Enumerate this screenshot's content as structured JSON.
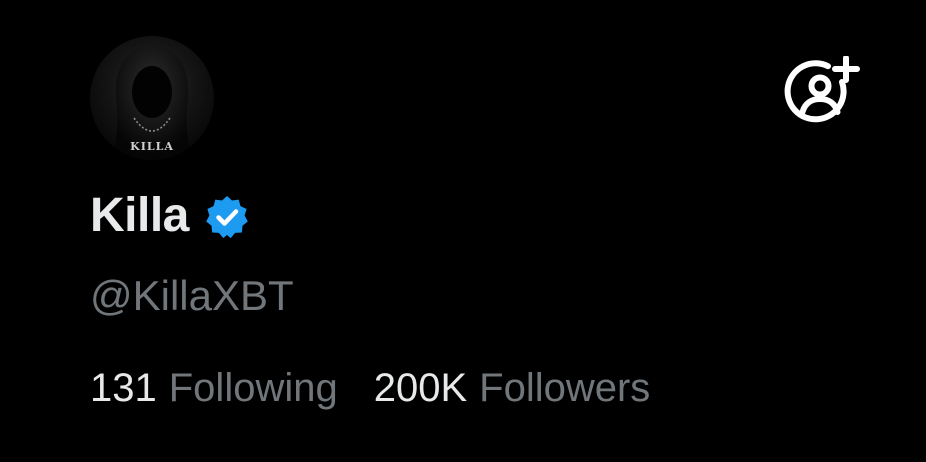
{
  "profile": {
    "display_name": "Killa",
    "handle": "@KillaXBT",
    "verified": true,
    "avatar_text": "KILLA",
    "avatar_icon": "hooded-figure-avatar"
  },
  "actions": {
    "follow_icon": "add-user-icon"
  },
  "stats": {
    "following_count": "131",
    "following_label": "Following",
    "followers_count": "200K",
    "followers_label": "Followers"
  },
  "colors": {
    "background": "#000000",
    "primary_text": "#e7e9ea",
    "secondary_text": "#71767b",
    "verified_blue": "#1d9bf0"
  }
}
